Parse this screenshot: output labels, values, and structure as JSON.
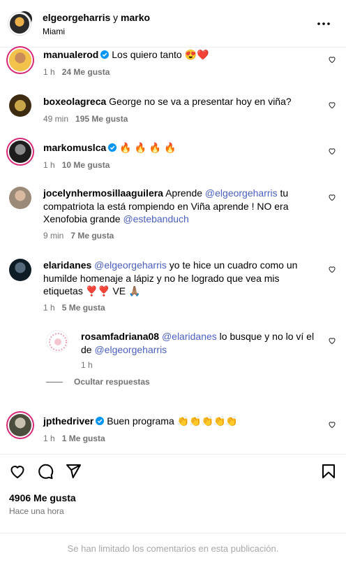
{
  "header": {
    "users": "elgeorgeharris",
    "connector": " y ",
    "second": "marko",
    "location": "Miami"
  },
  "comments": [
    {
      "user": "manualerod",
      "text": "Los quiero tanto 😍❤️",
      "time": "1 h",
      "likes": "24 Me gusta"
    },
    {
      "user": "boxeolagreca",
      "text": "George no se va a presentar hoy en viña?",
      "time": "49 min",
      "likes": "195 Me gusta"
    },
    {
      "user": "markomuslca",
      "text": "🔥 🔥 🔥 🔥",
      "time": "1 h",
      "likes": "10 Me gusta"
    },
    {
      "user": "jocelynhermosillaaguilera",
      "text1": "Aprende ",
      "mention1": "@elgeorgeharris",
      "text2": " tu",
      "line2": "compatriota la está rompiendo en Viña aprende ! NO era",
      "line3a": "Xenofobia grande ",
      "mention2": "@estebanduch",
      "time": "9 min",
      "likes": "7 Me gusta"
    },
    {
      "user": "elaridanes",
      "mention1": "@elgeorgeharris",
      "text1": " yo te hice un cuadro como un",
      "line2": "humilde homenaje a lápiz y no he logrado que vea mis",
      "line3": "etiquetas ❣️❣️ VE 🙏🏽",
      "time": "1 h",
      "likes": "5 Me gusta"
    },
    {
      "user": "rosamfadriana08",
      "mention1": "@elaridanes",
      "text1": " lo busque y no lo ví el",
      "line2a": "de ",
      "mention2": "@elgeorgeharris",
      "time": "1 h"
    },
    {
      "user": "jpthedriver",
      "text": "Buen programa 👏👏👏👏👏",
      "time": "1 h",
      "likes": "1 Me gusta"
    }
  ],
  "hide_replies": "Ocultar respuestas",
  "post": {
    "likes": "4906 Me gusta",
    "time": "Hace una hora"
  },
  "footer": "Se han limitado los comentarios en esta publicación.",
  "colors": {
    "mention": "#4a5fc1",
    "muted": "#737373",
    "ring": "#d62976"
  }
}
